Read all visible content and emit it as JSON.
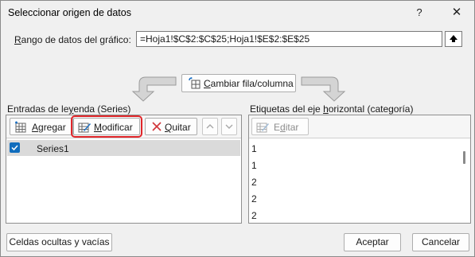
{
  "window": {
    "title": "Seleccionar origen de datos",
    "help_label": "?",
    "close_label": "✕"
  },
  "range": {
    "label_pre": "",
    "label_accel": "R",
    "label_post": "ango de datos del gráfico:",
    "value": "=Hoja1!$C$2:$C$25;Hoja1!$E$2:$E$25"
  },
  "switch_button": {
    "label_accel": "C",
    "label_post": "ambiar fila/columna"
  },
  "legend": {
    "title_pre": "Entradas de le",
    "title_accel": "y",
    "title_post": "enda (Series)",
    "add_accel": "A",
    "add_post": "gregar",
    "edit_accel": "M",
    "edit_post": "odificar",
    "remove_accel": "Q",
    "remove_post": "uitar",
    "series": [
      {
        "name": "Series1",
        "checked": true
      }
    ]
  },
  "axis": {
    "title_pre": "Etiquetas del eje ",
    "title_accel": "h",
    "title_post": "orizontal (categoría)",
    "edit_pre": "E",
    "edit_accel": "d",
    "edit_post": "itar",
    "labels": [
      "1",
      "1",
      "2",
      "2",
      "2"
    ]
  },
  "footer": {
    "hidden_cells_label": "Celdas ocultas y vacías",
    "ok_label": "Aceptar",
    "cancel_label": "Cancelar"
  },
  "colors": {
    "accent": "#0f6cbd",
    "highlight_border": "#e0262a",
    "selected_row": "#dadada"
  }
}
